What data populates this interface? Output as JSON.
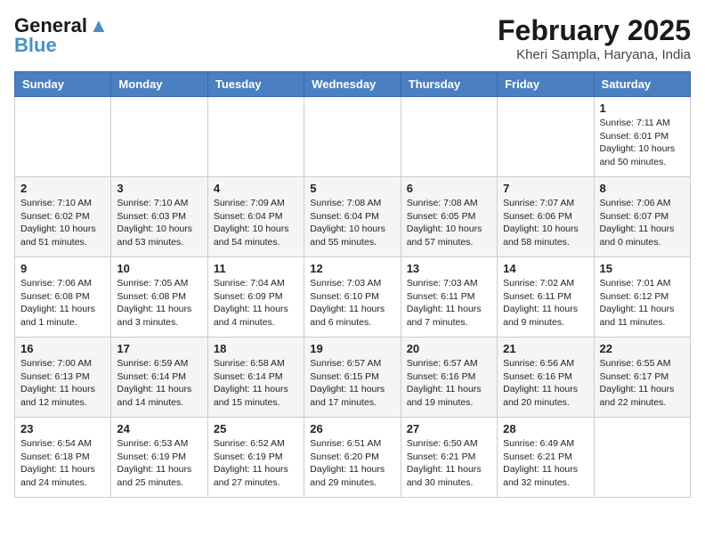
{
  "header": {
    "logo_general": "General",
    "logo_blue": "Blue",
    "title": "February 2025",
    "subtitle": "Kheri Sampla, Haryana, India"
  },
  "days_of_week": [
    "Sunday",
    "Monday",
    "Tuesday",
    "Wednesday",
    "Thursday",
    "Friday",
    "Saturday"
  ],
  "weeks": [
    [
      {
        "day": null
      },
      {
        "day": null
      },
      {
        "day": null
      },
      {
        "day": null
      },
      {
        "day": null
      },
      {
        "day": null
      },
      {
        "day": "1",
        "sunrise": "7:11 AM",
        "sunset": "6:01 PM",
        "daylight": "10 hours and 50 minutes"
      }
    ],
    [
      {
        "day": "2",
        "sunrise": "7:10 AM",
        "sunset": "6:02 PM",
        "daylight": "10 hours and 51 minutes"
      },
      {
        "day": "3",
        "sunrise": "7:10 AM",
        "sunset": "6:03 PM",
        "daylight": "10 hours and 53 minutes"
      },
      {
        "day": "4",
        "sunrise": "7:09 AM",
        "sunset": "6:04 PM",
        "daylight": "10 hours and 54 minutes"
      },
      {
        "day": "5",
        "sunrise": "7:08 AM",
        "sunset": "6:04 PM",
        "daylight": "10 hours and 55 minutes"
      },
      {
        "day": "6",
        "sunrise": "7:08 AM",
        "sunset": "6:05 PM",
        "daylight": "10 hours and 57 minutes"
      },
      {
        "day": "7",
        "sunrise": "7:07 AM",
        "sunset": "6:06 PM",
        "daylight": "10 hours and 58 minutes"
      },
      {
        "day": "8",
        "sunrise": "7:06 AM",
        "sunset": "6:07 PM",
        "daylight": "11 hours and 0 minutes"
      }
    ],
    [
      {
        "day": "9",
        "sunrise": "7:06 AM",
        "sunset": "6:08 PM",
        "daylight": "11 hours and 1 minute"
      },
      {
        "day": "10",
        "sunrise": "7:05 AM",
        "sunset": "6:08 PM",
        "daylight": "11 hours and 3 minutes"
      },
      {
        "day": "11",
        "sunrise": "7:04 AM",
        "sunset": "6:09 PM",
        "daylight": "11 hours and 4 minutes"
      },
      {
        "day": "12",
        "sunrise": "7:03 AM",
        "sunset": "6:10 PM",
        "daylight": "11 hours and 6 minutes"
      },
      {
        "day": "13",
        "sunrise": "7:03 AM",
        "sunset": "6:11 PM",
        "daylight": "11 hours and 7 minutes"
      },
      {
        "day": "14",
        "sunrise": "7:02 AM",
        "sunset": "6:11 PM",
        "daylight": "11 hours and 9 minutes"
      },
      {
        "day": "15",
        "sunrise": "7:01 AM",
        "sunset": "6:12 PM",
        "daylight": "11 hours and 11 minutes"
      }
    ],
    [
      {
        "day": "16",
        "sunrise": "7:00 AM",
        "sunset": "6:13 PM",
        "daylight": "11 hours and 12 minutes"
      },
      {
        "day": "17",
        "sunrise": "6:59 AM",
        "sunset": "6:14 PM",
        "daylight": "11 hours and 14 minutes"
      },
      {
        "day": "18",
        "sunrise": "6:58 AM",
        "sunset": "6:14 PM",
        "daylight": "11 hours and 15 minutes"
      },
      {
        "day": "19",
        "sunrise": "6:57 AM",
        "sunset": "6:15 PM",
        "daylight": "11 hours and 17 minutes"
      },
      {
        "day": "20",
        "sunrise": "6:57 AM",
        "sunset": "6:16 PM",
        "daylight": "11 hours and 19 minutes"
      },
      {
        "day": "21",
        "sunrise": "6:56 AM",
        "sunset": "6:16 PM",
        "daylight": "11 hours and 20 minutes"
      },
      {
        "day": "22",
        "sunrise": "6:55 AM",
        "sunset": "6:17 PM",
        "daylight": "11 hours and 22 minutes"
      }
    ],
    [
      {
        "day": "23",
        "sunrise": "6:54 AM",
        "sunset": "6:18 PM",
        "daylight": "11 hours and 24 minutes"
      },
      {
        "day": "24",
        "sunrise": "6:53 AM",
        "sunset": "6:19 PM",
        "daylight": "11 hours and 25 minutes"
      },
      {
        "day": "25",
        "sunrise": "6:52 AM",
        "sunset": "6:19 PM",
        "daylight": "11 hours and 27 minutes"
      },
      {
        "day": "26",
        "sunrise": "6:51 AM",
        "sunset": "6:20 PM",
        "daylight": "11 hours and 29 minutes"
      },
      {
        "day": "27",
        "sunrise": "6:50 AM",
        "sunset": "6:21 PM",
        "daylight": "11 hours and 30 minutes"
      },
      {
        "day": "28",
        "sunrise": "6:49 AM",
        "sunset": "6:21 PM",
        "daylight": "11 hours and 32 minutes"
      },
      {
        "day": null
      }
    ]
  ]
}
